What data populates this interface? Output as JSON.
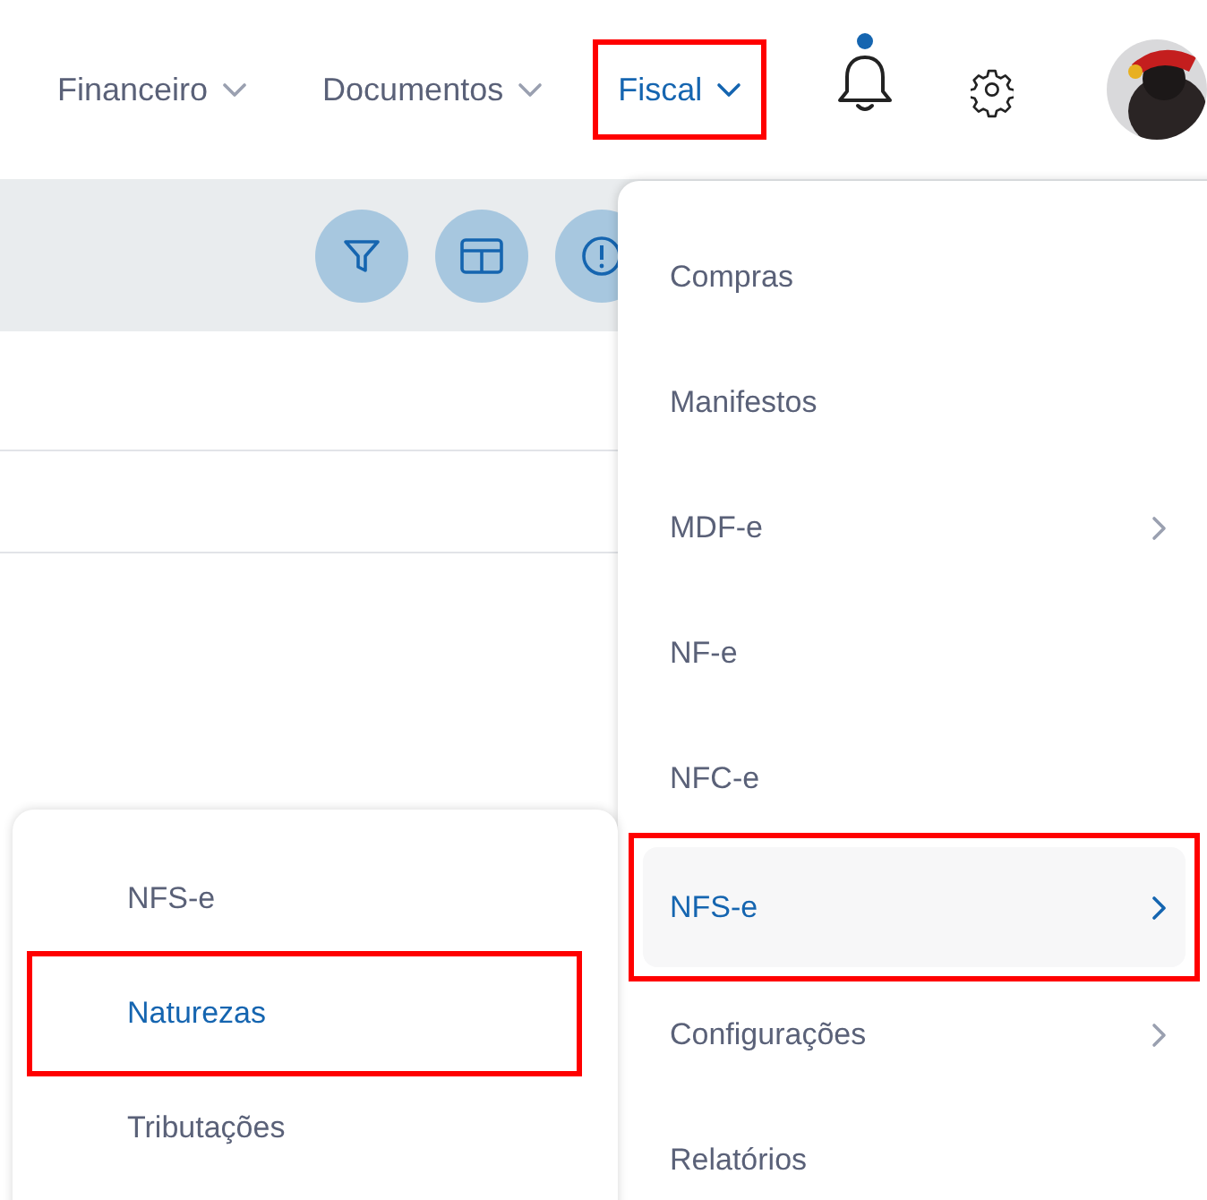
{
  "nav": [
    {
      "label": "Financeiro",
      "selected": false,
      "highlighted": false
    },
    {
      "label": "Documentos",
      "selected": false,
      "highlighted": false
    },
    {
      "label": "Fiscal",
      "selected": true,
      "highlighted": true
    }
  ],
  "notifications": {
    "unread": true
  },
  "toolbar": {
    "buttons": [
      {
        "kind": "filter"
      },
      {
        "kind": "columns"
      },
      {
        "kind": "info"
      }
    ]
  },
  "menu": {
    "items": [
      {
        "label": "Compras",
        "has_submenu": false,
        "selected": false,
        "highlighted": false
      },
      {
        "label": "Manifestos",
        "has_submenu": false,
        "selected": false,
        "highlighted": false
      },
      {
        "label": "MDF-e",
        "has_submenu": true,
        "selected": false,
        "highlighted": false
      },
      {
        "label": "NF-e",
        "has_submenu": false,
        "selected": false,
        "highlighted": false
      },
      {
        "label": "NFC-e",
        "has_submenu": false,
        "selected": false,
        "highlighted": false
      },
      {
        "label": "NFS-e",
        "has_submenu": true,
        "selected": true,
        "highlighted": true
      },
      {
        "label": "Configurações",
        "has_submenu": true,
        "selected": false,
        "highlighted": false
      },
      {
        "label": "Relatórios",
        "has_submenu": false,
        "selected": false,
        "highlighted": false
      }
    ]
  },
  "submenu": {
    "items": [
      {
        "label": "NFS-e",
        "selected": false,
        "highlighted": false
      },
      {
        "label": "Naturezas",
        "selected": true,
        "highlighted": true
      },
      {
        "label": "Tributações",
        "selected": false,
        "highlighted": false
      }
    ]
  }
}
